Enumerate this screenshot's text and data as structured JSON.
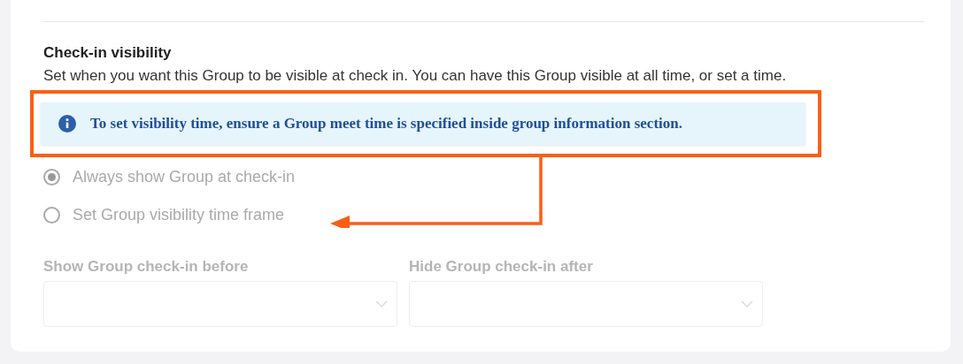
{
  "section": {
    "title": "Check-in visibility",
    "description": "Set when you want this Group to be visible at check in. You can have this Group visible at all time, or set a time."
  },
  "info": {
    "text": "To set visibility time, ensure a Group meet time is specified inside group information section.",
    "highlighted": true
  },
  "options": [
    {
      "label": "Always show Group at check-in",
      "selected": true,
      "disabled": true
    },
    {
      "label": "Set Group visibility time frame",
      "selected": false,
      "disabled": true
    }
  ],
  "fields": [
    {
      "label": "Show Group check-in before",
      "disabled": true
    },
    {
      "label": "Hide Group check-in after",
      "disabled": true
    }
  ]
}
